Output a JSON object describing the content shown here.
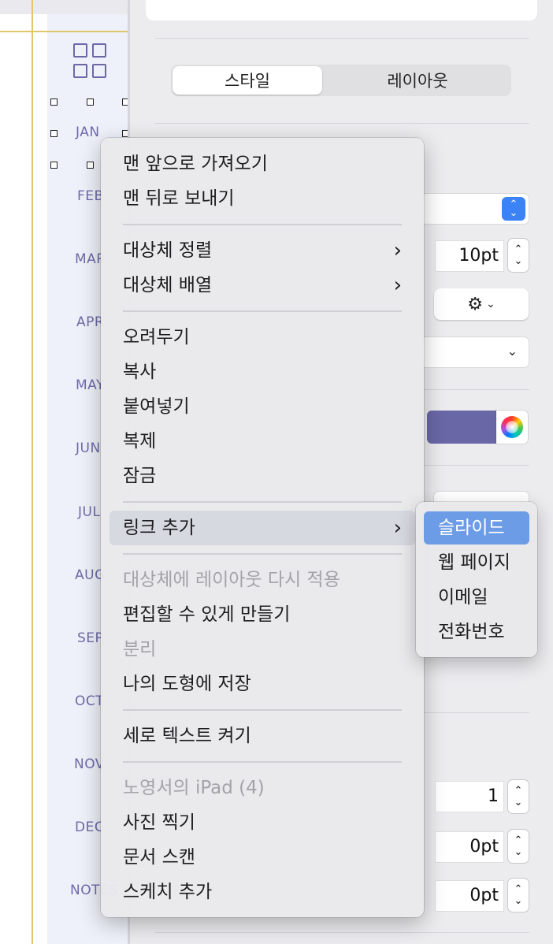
{
  "canvas": {
    "months": [
      "JAN",
      "FEB",
      "MAR",
      "APR",
      "MAY",
      "JUN",
      "JUL",
      "AUG",
      "SEP",
      "OCT",
      "NOV",
      "DEC",
      "NOTES"
    ]
  },
  "inspector": {
    "tabs": [
      "스타일",
      "레이아웃"
    ],
    "fields": {
      "size_pt": "10pt",
      "count": "1",
      "spacing_a": "0pt",
      "spacing_b": "0pt"
    },
    "fill_color": "#6a67a6"
  },
  "context_menu": {
    "items": [
      {
        "label": "맨 앞으로 가져오기",
        "enabled": true
      },
      {
        "label": "맨 뒤로 보내기",
        "enabled": true
      },
      {
        "label": "대상체 정렬",
        "enabled": true,
        "submenu": true
      },
      {
        "label": "대상체 배열",
        "enabled": true,
        "submenu": true
      },
      {
        "label": "오려두기",
        "enabled": true
      },
      {
        "label": "복사",
        "enabled": true
      },
      {
        "label": "붙여넣기",
        "enabled": true
      },
      {
        "label": "복제",
        "enabled": true
      },
      {
        "label": "잠금",
        "enabled": true
      },
      {
        "label": "링크 추가",
        "enabled": true,
        "submenu": true,
        "highlighted": true
      },
      {
        "label": "대상체에 레이아웃 다시 적용",
        "enabled": false
      },
      {
        "label": "편집할 수 있게 만들기",
        "enabled": true
      },
      {
        "label": "분리",
        "enabled": false
      },
      {
        "label": "나의 도형에 저장",
        "enabled": true
      },
      {
        "label": "세로 텍스트 켜기",
        "enabled": true
      },
      {
        "label": "노영서의 iPad (4)",
        "enabled": false
      },
      {
        "label": "사진 찍기",
        "enabled": true
      },
      {
        "label": "문서 스캔",
        "enabled": true
      },
      {
        "label": "스케치 추가",
        "enabled": true
      }
    ]
  },
  "link_submenu": {
    "items": [
      "슬라이드",
      "웹 페이지",
      "이메일",
      "전화번호"
    ],
    "selected": "슬라이드"
  }
}
